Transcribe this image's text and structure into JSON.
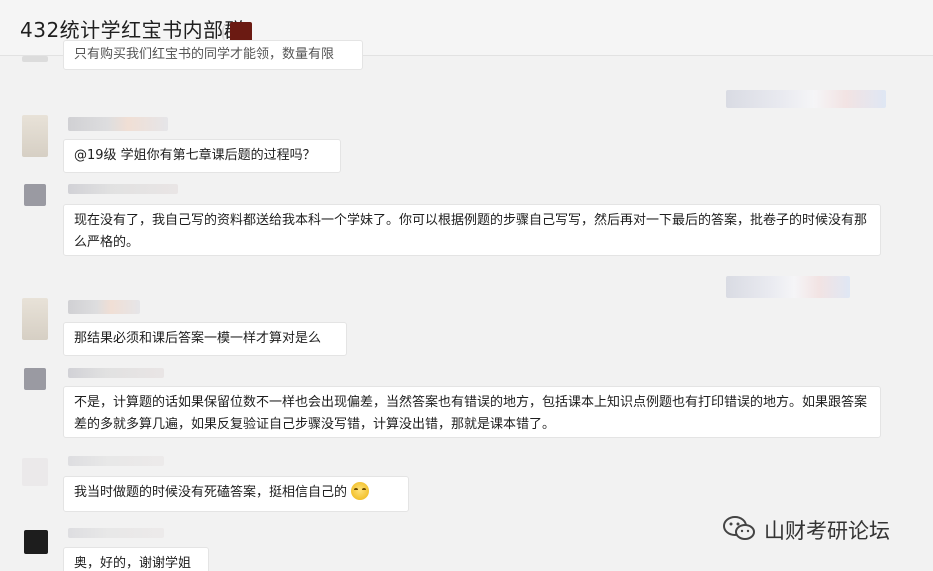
{
  "header": {
    "title": "432统计学红宝书内部群"
  },
  "messages": [
    {
      "text": "只有购买我们红宝书的同学才能领，数量有限"
    },
    {
      "text": "@19级 学姐你有第七章课后题的过程吗？"
    },
    {
      "text": "现在没有了，我自己写的资料都送给我本科一个学妹了。你可以根据例题的步骤自己写写，然后再对一下最后的答案，批卷子的时候没有那么严格的。"
    },
    {
      "text": "那结果必须和课后答案一模一样才算对是么"
    },
    {
      "text": "不是，计算题的话如果保留位数不一样也会出现偏差，当然答案也有错误的地方，包括课本上知识点例题也有打印错误的地方。如果跟答案差的多就多算几遍，如果反复验证自己步骤没写错，计算没出错，那就是课本错了。"
    },
    {
      "text": "我当时做题的时候没有死磕答案，挺相信自己的"
    },
    {
      "text": "奥，好的，谢谢学姐"
    }
  ],
  "watermark": {
    "text": "山财考研论坛",
    "icon": "wechat-icon"
  }
}
